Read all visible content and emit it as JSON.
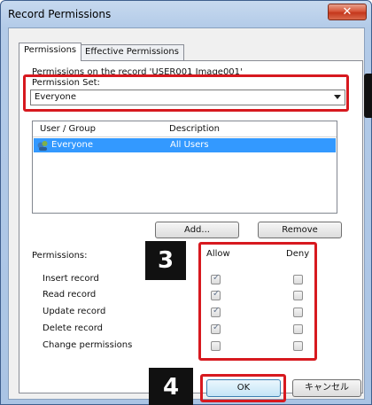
{
  "window": {
    "title": "Record Permissions"
  },
  "tabs": [
    {
      "label": "Permissions",
      "active": true
    },
    {
      "label": "Effective Permissions",
      "active": false
    }
  ],
  "record_info": "Permissions on the record 'USER001 Image001'",
  "permission_set": {
    "label": "Permission Set:",
    "value": "Everyone"
  },
  "user_list": {
    "columns": [
      "User / Group",
      "Description"
    ],
    "rows": [
      {
        "user": "Everyone",
        "description": "All Users",
        "selected": true
      }
    ]
  },
  "buttons": {
    "add": "Add...",
    "remove": "Remove",
    "ok": "OK",
    "cancel": "キャンセル"
  },
  "permissions": {
    "label": "Permissions:",
    "allow_header": "Allow",
    "deny_header": "Deny",
    "items": [
      {
        "name": "Insert record",
        "allow": true,
        "deny": false
      },
      {
        "name": "Read record",
        "allow": true,
        "deny": false
      },
      {
        "name": "Update record",
        "allow": true,
        "deny": false
      },
      {
        "name": "Delete record",
        "allow": true,
        "deny": false
      },
      {
        "name": "Change permissions",
        "allow": false,
        "deny": false
      }
    ]
  },
  "annotations": {
    "step3": "3",
    "step4": "4"
  },
  "colors": {
    "highlight_red": "#d7191f",
    "selection_blue": "#3399ff",
    "title_bar": "#b3cbe8"
  }
}
